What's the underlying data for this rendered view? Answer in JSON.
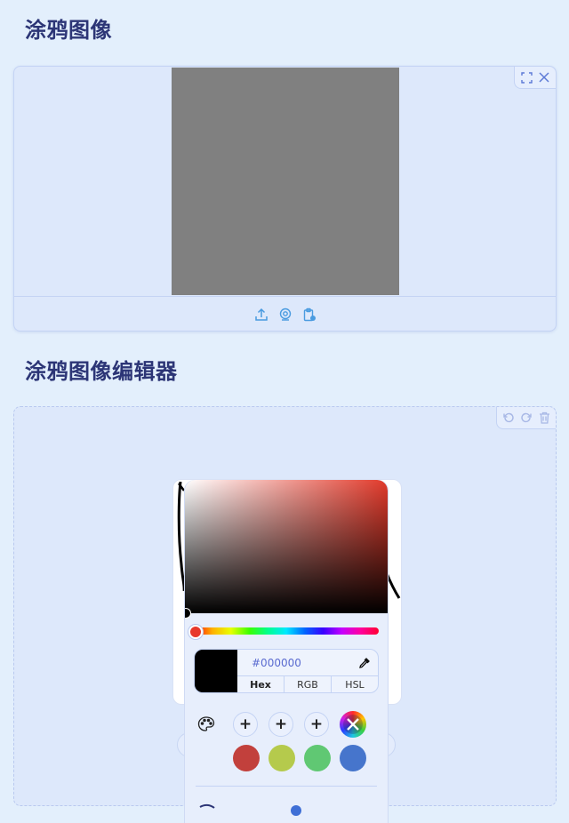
{
  "sections": {
    "sketch_title": "涂鸦图像",
    "editor_title": "涂鸦图像编辑器"
  },
  "canvas1": {
    "icons": [
      "fullscreen-icon",
      "close-icon"
    ],
    "sources": [
      "upload-icon",
      "webcam-icon",
      "clipboard-icon"
    ]
  },
  "editor": {
    "toolbar_icons": [
      "undo-icon",
      "redo-icon",
      "trash-icon"
    ]
  },
  "color_picker": {
    "hex_value": "#000000",
    "modes": [
      "Hex",
      "RGB",
      "HSL"
    ],
    "active_mode": "Hex",
    "hue_color": "#e23a2b",
    "selected_color": "#000000",
    "add_buttons": [
      "+",
      "+",
      "+"
    ],
    "preset_colors": [
      "#c2403c",
      "#b5ca4c",
      "#60c873",
      "#4675cc"
    ]
  }
}
